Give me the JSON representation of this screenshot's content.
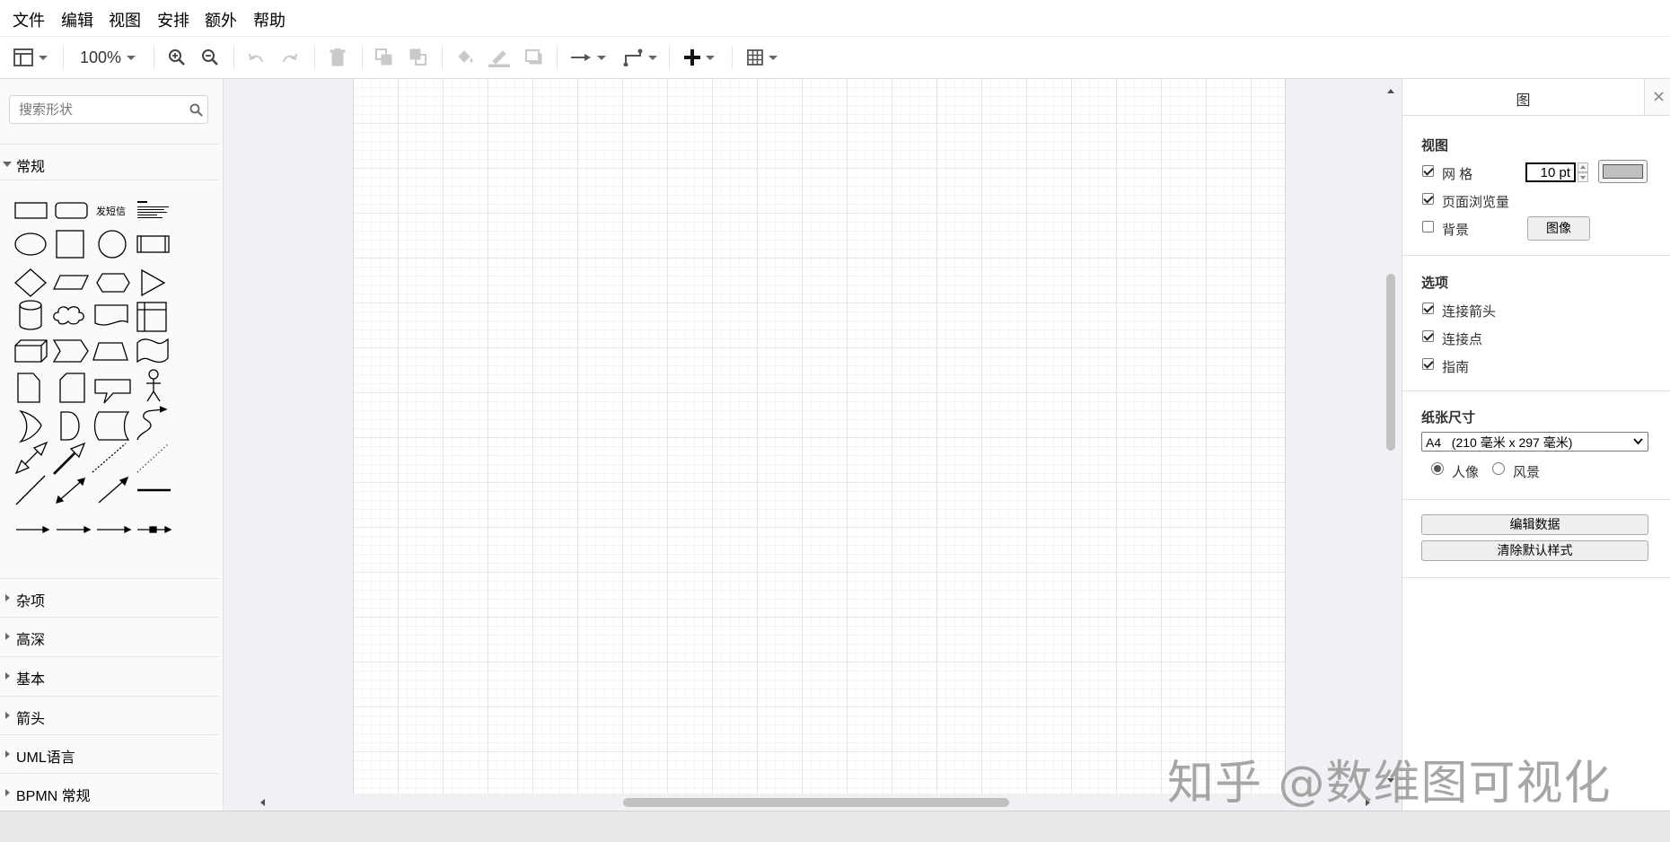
{
  "menu": [
    "文件",
    "编辑",
    "视图",
    "安排",
    "额外",
    "帮助"
  ],
  "toolbar": {
    "zoom": "100%",
    "icons": [
      "layout-icon",
      "zoom-in-icon",
      "zoom-out-icon",
      "undo-icon",
      "redo-icon",
      "delete-icon",
      "to-front-icon",
      "to-back-icon",
      "fill-color-icon",
      "line-color-icon",
      "shadow-icon",
      "connection-icon",
      "waypoints-icon",
      "insert-icon",
      "table-icon"
    ]
  },
  "sidebar": {
    "search_placeholder": "搜索形状",
    "general_label": "常规",
    "shape_text_sample": "发短信",
    "sections": [
      "杂项",
      "高深",
      "基本",
      "箭头",
      "UML语言",
      "BPMN 常规"
    ]
  },
  "panel": {
    "tab_title": "图",
    "view_title": "视图",
    "grid_label": "网 格",
    "grid_size": "10 pt",
    "grid_checked": true,
    "page_view_label": "页面浏览量",
    "page_view_checked": true,
    "background_label": "背景",
    "background_checked": false,
    "image_button": "图像",
    "options_title": "选项",
    "connection_arrows_label": "连接箭头",
    "connection_points_label": "连接点",
    "guides_label": "指南",
    "paper_title": "纸张尺寸",
    "paper_size": "A4   (210 毫米 x 297 毫米)",
    "portrait_label": "人像",
    "landscape_label": "风景",
    "portrait_selected": true,
    "edit_data_button": "编辑数据",
    "clear_style_button": "清除默认样式"
  },
  "colors": {
    "grid_color_swatch": "#c0c0c0",
    "canvas_bg": "#f0f1f4"
  },
  "watermark": "知乎 @数维图可视化"
}
